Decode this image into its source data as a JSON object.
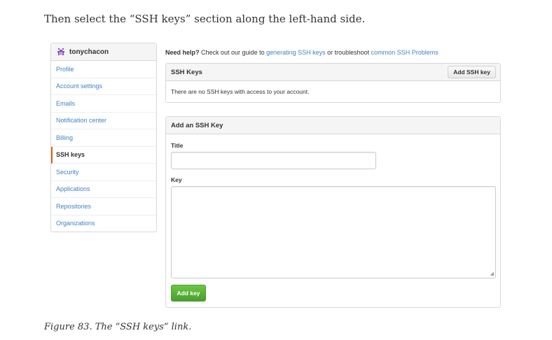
{
  "intro_text": "Then select the “SSH keys” section along the left-hand side.",
  "caption": "Figure 83. The “SSH keys” link.",
  "sidebar": {
    "username": "tonychacon",
    "items": [
      {
        "label": "Profile",
        "active": false
      },
      {
        "label": "Account settings",
        "active": false
      },
      {
        "label": "Emails",
        "active": false
      },
      {
        "label": "Notification center",
        "active": false
      },
      {
        "label": "Billing",
        "active": false
      },
      {
        "label": "SSH keys",
        "active": true
      },
      {
        "label": "Security",
        "active": false
      },
      {
        "label": "Applications",
        "active": false
      },
      {
        "label": "Repositories",
        "active": false
      },
      {
        "label": "Organizations",
        "active": false
      }
    ]
  },
  "help": {
    "lead": "Need help?",
    "text1": " Check out our guide to ",
    "link1": "generating SSH keys",
    "text2": " or troubleshoot ",
    "link2": "common SSH Problems"
  },
  "ssh_keys_panel": {
    "title": "SSH Keys",
    "add_button": "Add SSH key",
    "empty_message": "There are no SSH keys with access to your account."
  },
  "add_key_panel": {
    "title": "Add an SSH Key",
    "title_label": "Title",
    "title_value": "",
    "key_label": "Key",
    "key_value": "",
    "submit_button": "Add key"
  },
  "colors": {
    "link": "#4183c4",
    "active_marker": "#d26911",
    "submit_green": "#6cc644",
    "avatar_purple": "#8e55c4"
  }
}
